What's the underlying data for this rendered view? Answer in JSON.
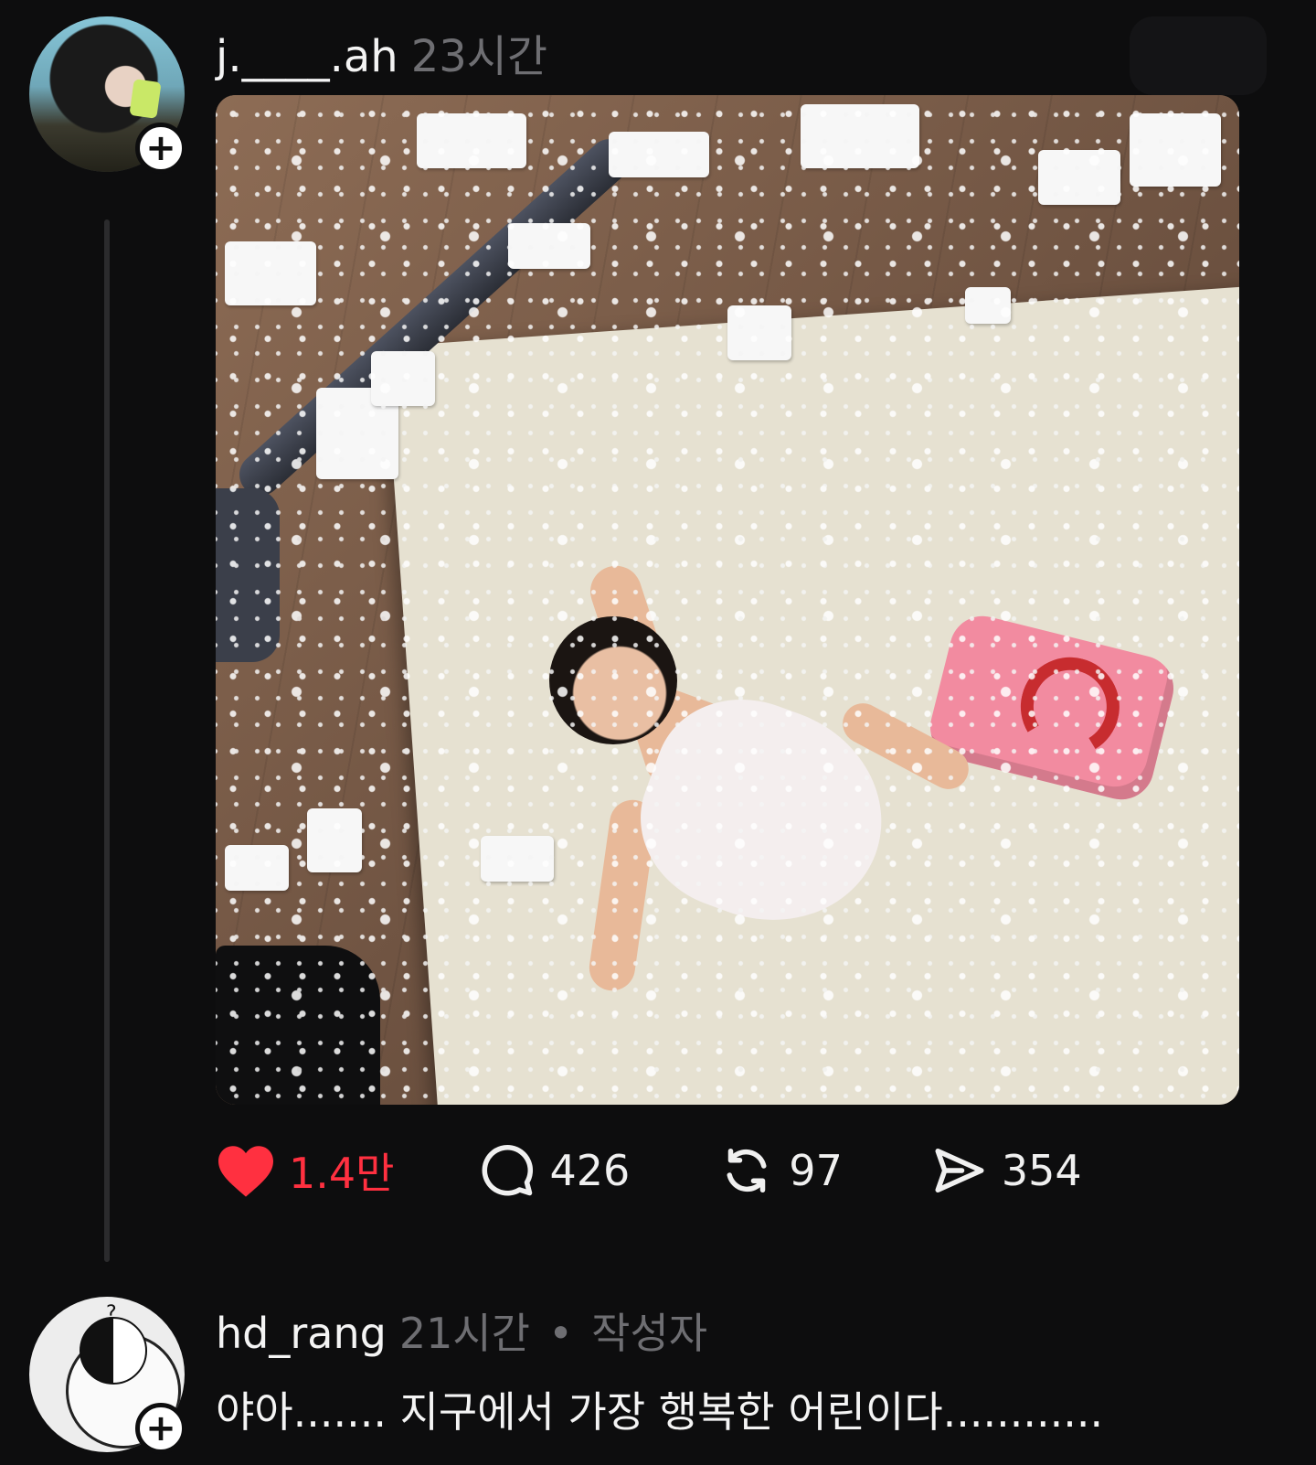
{
  "post": {
    "username": "j.____.ah",
    "time": "23시간",
    "stats": {
      "likes": "1.4만",
      "comments": "426",
      "reposts": "97",
      "shares": "354"
    }
  },
  "reply": {
    "username": "hd_rang",
    "time": "21시간",
    "separator": "•",
    "author_tag": "작성자",
    "text": "야아....... 지구에서 가장 행복한 어린이다............"
  },
  "colors": {
    "background": "#0d0d0e",
    "like_red": "#ff3040",
    "muted_text": "#6e6e72"
  },
  "icons": [
    "plus-icon",
    "heart-icon",
    "comment-icon",
    "repost-icon",
    "share-icon"
  ]
}
